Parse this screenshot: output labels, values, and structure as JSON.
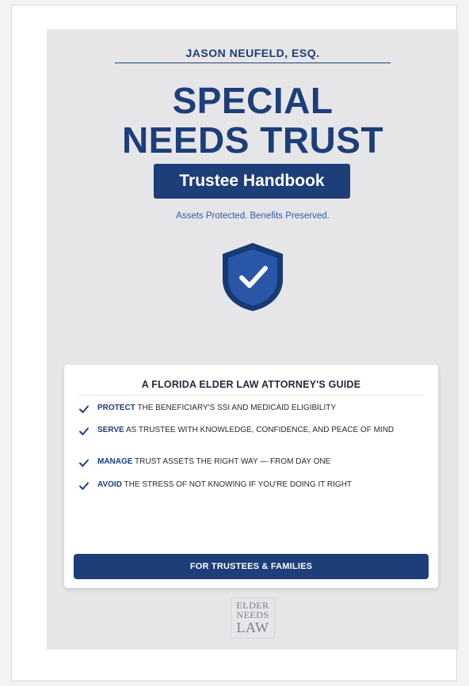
{
  "book": {
    "author": "JASON NEUFELD, ESQ.",
    "title_line1": "SPECIAL",
    "title_line2": "NEEDS TRUST",
    "subtitle": "Trustee Handbook",
    "tagline": "Assets Protected. Benefits Preserved."
  },
  "card": {
    "heading": "A FLORIDA ELDER LAW ATTORNEY'S GUIDE",
    "bullets": [
      {
        "lead": "PROTECT",
        "text": " THE BENEFICIARY'S SSI AND MEDICAID ELIGIBILITY"
      },
      {
        "lead": "SERVE",
        "text": " AS TRUSTEE WITH KNOWLEDGE, CONFIDENCE, AND PEACE OF MIND"
      },
      {
        "lead": "MANAGE",
        "text": " TRUST ASSETS THE RIGHT WAY — FROM DAY ONE"
      },
      {
        "lead": "AVOID",
        "text": " THE STRESS OF NOT KNOWING IF YOU'RE DOING IT RIGHT"
      }
    ],
    "footer_label": "FOR TRUSTEES & FAMILIES"
  },
  "logo": {
    "line1": "ELDER",
    "line2": "NEEDS",
    "line3": "LAW"
  },
  "colors": {
    "navy": "#1d3e78",
    "background": "#e6e6e8",
    "shield_fill": "#2a56a8"
  },
  "icons": [
    "shield-check-icon",
    "check-icon"
  ]
}
